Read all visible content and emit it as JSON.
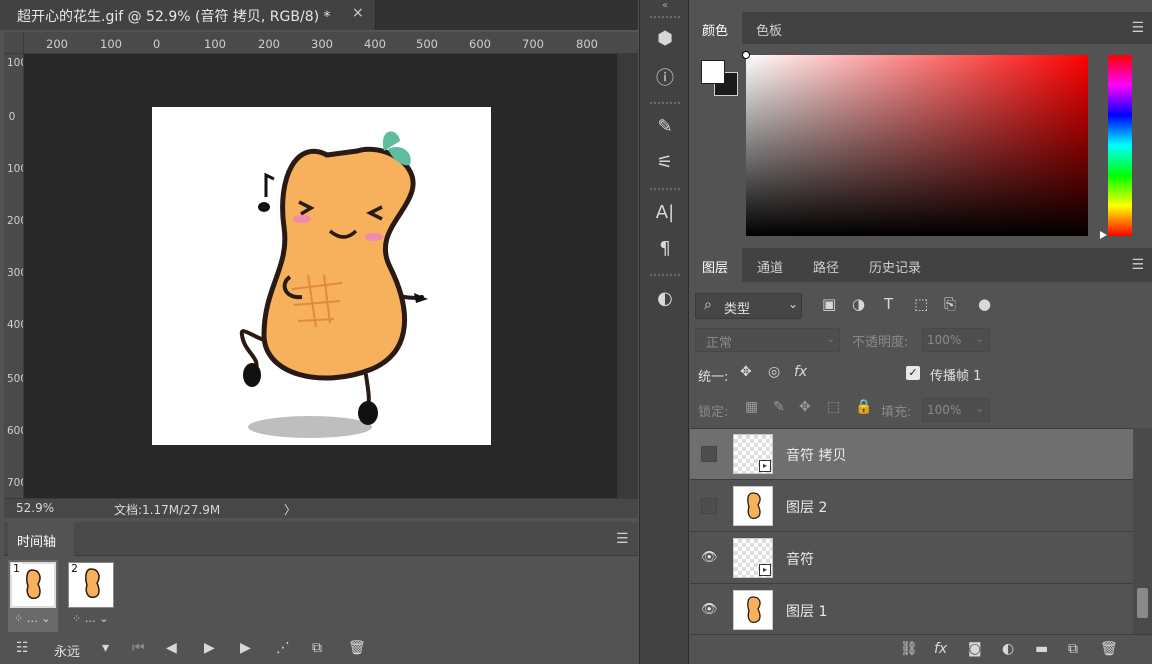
{
  "document": {
    "tab_title": "超开心的花生.gif @ 52.9% (音符 拷贝, RGB/8) *",
    "close_glyph": "×",
    "ruler_top_labels": [
      "200",
      "100",
      "0",
      "100",
      "200",
      "300",
      "400",
      "500",
      "600",
      "700",
      "800"
    ],
    "ruler_left_labels": [
      "100",
      "0",
      "100",
      "200",
      "300",
      "400",
      "500",
      "600",
      "700"
    ],
    "zoom": "52.9%",
    "doc_size": "文档:1.17M/27.9M",
    "status_arrow": "〉"
  },
  "timeline": {
    "tab_label": "时间轴",
    "frames": [
      {
        "number": "1",
        "delay": "…"
      },
      {
        "number": "2",
        "delay": "…"
      }
    ],
    "loop": "永远"
  },
  "color_panel": {
    "tab_color": "颜色",
    "tab_swatches": "色板",
    "foreground_color": "#ffffff",
    "background_color": "#1a1a1a",
    "picker_hue": "#ff0000"
  },
  "layers_panel": {
    "tabs": [
      "图层",
      "通道",
      "路径",
      "历史记录"
    ],
    "filter_label": "类型",
    "blend_mode": "正常",
    "opacity_label": "不透明度:",
    "opacity_value": "100%",
    "unify_label": "统一:",
    "propagate_label": "传播帧 1",
    "lock_label": "锁定:",
    "fill_label": "填充:",
    "fill_value": "100%",
    "layers": [
      {
        "name": "音符 拷贝",
        "visible": false,
        "selected": true
      },
      {
        "name": "图层 2",
        "visible": false,
        "selected": false
      },
      {
        "name": "音符",
        "visible": true,
        "selected": false
      },
      {
        "name": "图层 1",
        "visible": true,
        "selected": false
      }
    ]
  }
}
